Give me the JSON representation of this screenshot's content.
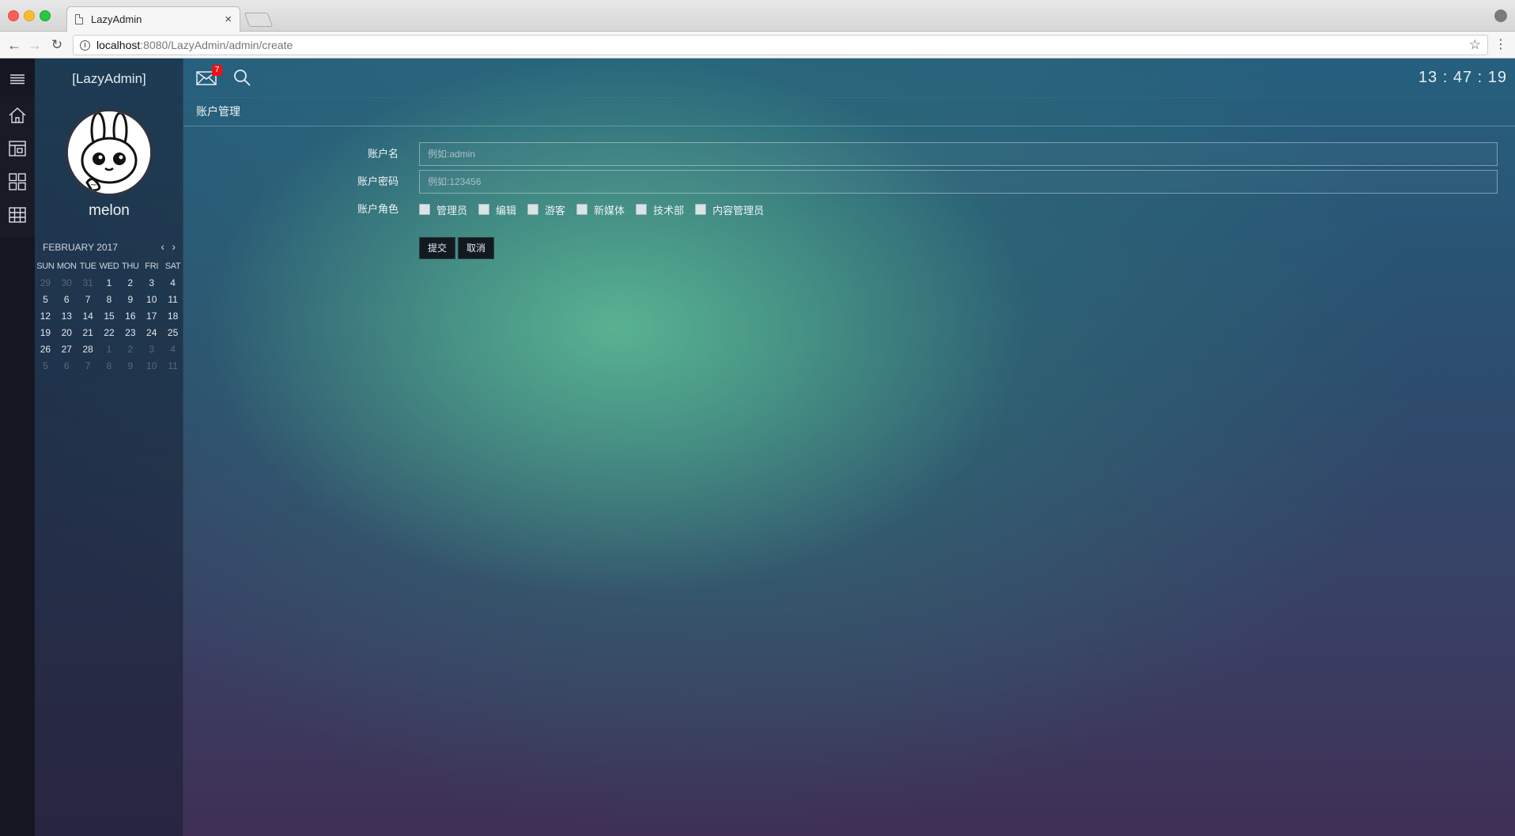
{
  "browser": {
    "tab_title": "LazyAdmin",
    "tab_close": "×",
    "url_host": "localhost",
    "url_rest": ":8080/LazyAdmin/admin/create"
  },
  "icons": {
    "back": "arrow-left",
    "forward": "arrow-right",
    "reload": "reload",
    "star": "star",
    "menu": "more-vertical",
    "hamburger": "hamburger",
    "home": "home",
    "dashboard": "dashboard",
    "grid": "grid",
    "table": "table",
    "mail": "envelope",
    "search": "search"
  },
  "sidebar": {
    "brand": "[LazyAdmin]",
    "username": "melon"
  },
  "calendar": {
    "title": "FEBRUARY 2017",
    "days_of_week": [
      "SUN",
      "MON",
      "TUE",
      "WED",
      "THU",
      "FRI",
      "SAT"
    ],
    "weeks": [
      [
        {
          "d": "29",
          "m": true
        },
        {
          "d": "30",
          "m": true
        },
        {
          "d": "31",
          "m": true
        },
        {
          "d": "1"
        },
        {
          "d": "2"
        },
        {
          "d": "3"
        },
        {
          "d": "4"
        }
      ],
      [
        {
          "d": "5"
        },
        {
          "d": "6"
        },
        {
          "d": "7"
        },
        {
          "d": "8"
        },
        {
          "d": "9"
        },
        {
          "d": "10"
        },
        {
          "d": "11"
        }
      ],
      [
        {
          "d": "12"
        },
        {
          "d": "13"
        },
        {
          "d": "14"
        },
        {
          "d": "15"
        },
        {
          "d": "16"
        },
        {
          "d": "17"
        },
        {
          "d": "18"
        }
      ],
      [
        {
          "d": "19"
        },
        {
          "d": "20"
        },
        {
          "d": "21"
        },
        {
          "d": "22"
        },
        {
          "d": "23"
        },
        {
          "d": "24"
        },
        {
          "d": "25"
        }
      ],
      [
        {
          "d": "26"
        },
        {
          "d": "27"
        },
        {
          "d": "28"
        },
        {
          "d": "1",
          "m": true
        },
        {
          "d": "2",
          "m": true
        },
        {
          "d": "3",
          "m": true
        },
        {
          "d": "4",
          "m": true
        }
      ],
      [
        {
          "d": "5",
          "m": true
        },
        {
          "d": "6",
          "m": true
        },
        {
          "d": "7",
          "m": true
        },
        {
          "d": "8",
          "m": true
        },
        {
          "d": "9",
          "m": true
        },
        {
          "d": "10",
          "m": true
        },
        {
          "d": "11",
          "m": true
        }
      ]
    ]
  },
  "topbar": {
    "mail_badge": "7",
    "clock": "13 : 47 : 19"
  },
  "page": {
    "title": "账户管理"
  },
  "form": {
    "account_name_label": "账户名",
    "account_name_placeholder": "例如:admin",
    "account_name_value": "",
    "password_label": "账户密码",
    "password_placeholder": "例如:123456",
    "password_value": "",
    "roles_label": "账户角色",
    "roles": [
      {
        "label": "管理员",
        "checked": false
      },
      {
        "label": "编辑",
        "checked": false
      },
      {
        "label": "游客",
        "checked": false
      },
      {
        "label": "新媒体",
        "checked": false
      },
      {
        "label": "技术部",
        "checked": false
      },
      {
        "label": "内容管理员",
        "checked": false
      }
    ],
    "submit_label": "提交",
    "cancel_label": "取消"
  }
}
